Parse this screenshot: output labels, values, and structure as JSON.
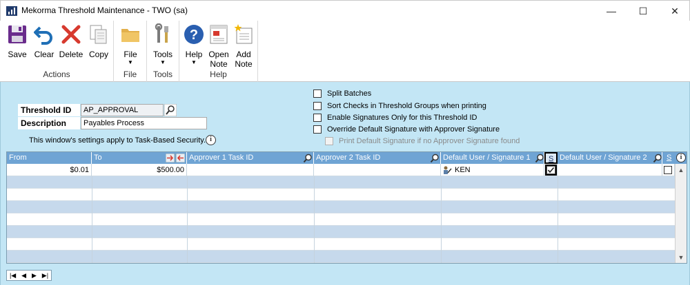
{
  "window": {
    "title": "Mekorma Threshold Maintenance  -  TWO (sa)",
    "minimize": "—",
    "maximize": "☐",
    "close": "✕"
  },
  "ribbon": {
    "actions": {
      "group_label": "Actions",
      "save": "Save",
      "clear": "Clear",
      "delete": "Delete",
      "copy": "Copy"
    },
    "file": {
      "group_label": "File",
      "file": "File"
    },
    "tools": {
      "group_label": "Tools",
      "tools": "Tools"
    },
    "help": {
      "group_label": "Help",
      "help": "Help",
      "open_note_1": "Open",
      "open_note_2": "Note",
      "add_note_1": "Add",
      "add_note_2": "Note"
    },
    "dropdown_arrow": "▼"
  },
  "form": {
    "threshold_id_label": "Threshold ID",
    "threshold_id_value": "AP_APPROVAL",
    "description_label": "Description",
    "description_value": "Payables Process",
    "security_note": "This window's settings apply to Task-Based Security.",
    "info_glyph": "i"
  },
  "options": [
    {
      "label": "Split Batches",
      "checked": false,
      "disabled": false
    },
    {
      "label": "Sort Checks in Threshold Groups when printing",
      "checked": false,
      "disabled": false
    },
    {
      "label": "Enable Signatures Only for this Threshold ID",
      "checked": false,
      "disabled": false
    },
    {
      "label": "Override Default Signature with Approver Signature",
      "checked": false,
      "disabled": false
    },
    {
      "label": "Print Default Signature if no Approver Signature found",
      "checked": false,
      "disabled": true
    }
  ],
  "grid": {
    "headers": {
      "from": "From",
      "to": "To",
      "approver1": "Approver 1 Task ID",
      "approver2": "Approver 2 Task ID",
      "default_sig1": "Default User / Signature 1",
      "s1": "S",
      "default_sig2": "Default User / Signature 2",
      "s2": "S"
    },
    "rows": [
      {
        "from": "$0.01",
        "to": "$500.00",
        "approver1": "",
        "approver2": "",
        "sig1": "KEN",
        "s1_checked": true,
        "sig2": "",
        "s2_checked": false
      }
    ],
    "empty_rows": 7
  },
  "nav": {
    "first": "|◀",
    "prev": "◀",
    "next": "▶",
    "last": "▶|"
  },
  "colors": {
    "form_bg": "#c3e6f5",
    "grid_header": "#6fa4d4",
    "alt_row": "#c6d9ec",
    "accent_red": "#d73a2f"
  }
}
